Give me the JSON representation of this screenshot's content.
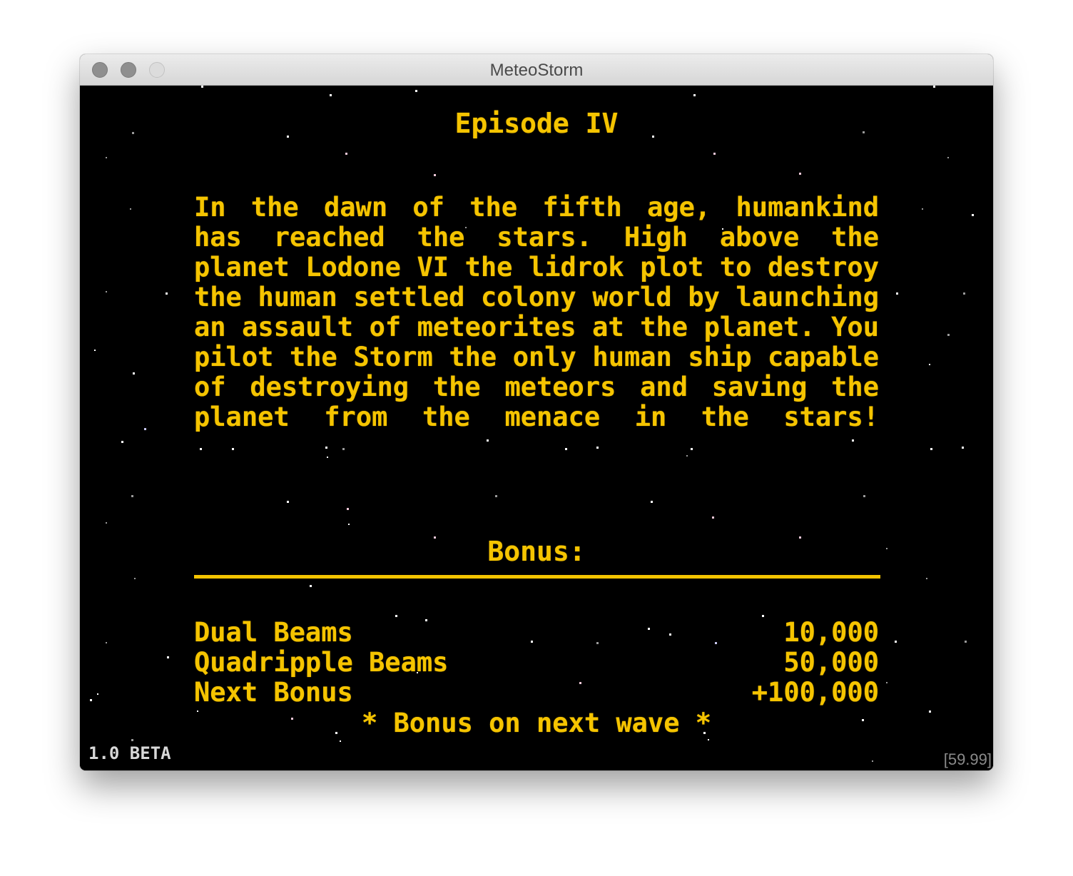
{
  "window": {
    "title": "MeteoStorm"
  },
  "game": {
    "episode_title": "Episode IV",
    "crawl_lines": [
      "In the dawn of the fifth age, humankind",
      "has reached the stars. High above the",
      "planet Lodone VI the lidrok plot to destroy",
      "the human settled colony world by launching",
      "an assault of meteorites at the planet. You",
      "pilot the Storm the only human ship capable",
      "of destroying the meteors and saving the",
      "planet from the menace in the stars!"
    ],
    "bonus": {
      "heading": "Bonus:",
      "rows": [
        {
          "label": "Dual Beams",
          "value": "10,000"
        },
        {
          "label": "Quadripple Beams",
          "value": "50,000"
        },
        {
          "label": "Next Bonus",
          "value": "+100,000"
        }
      ],
      "footer": "* Bonus on next wave *"
    },
    "version": "1.0 BETA",
    "fps": "[59.99]"
  },
  "colors": {
    "text_yellow": "#f5c400",
    "background": "#000000",
    "version_text": "#d8d8d8",
    "fps_text": "#8a8a8a"
  }
}
